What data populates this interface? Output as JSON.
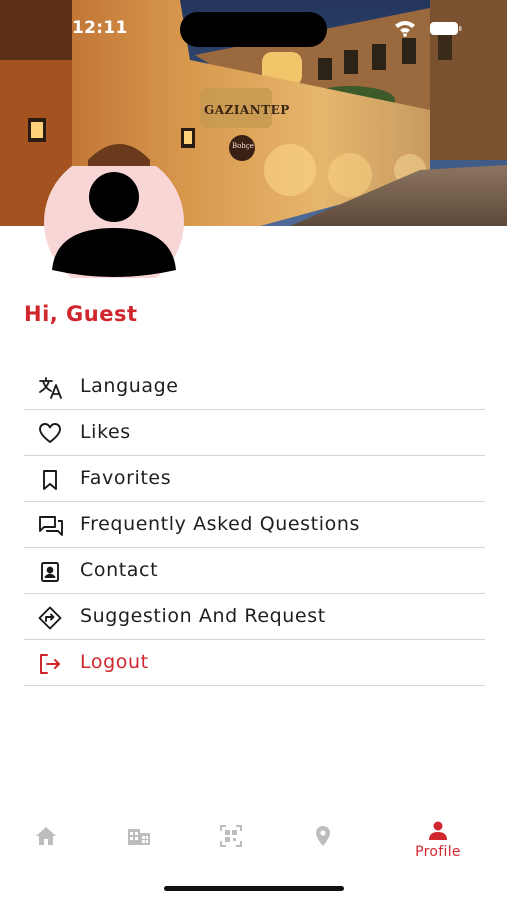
{
  "status_bar": {
    "time": "12:11"
  },
  "hero": {
    "sign_text": "GAZIANTEP",
    "sign_small": "Bohçe"
  },
  "profile": {
    "greeting": "Hi, Guest"
  },
  "menu": [
    {
      "label": "Language",
      "icon": "translate-icon"
    },
    {
      "label": "Likes",
      "icon": "heart-icon"
    },
    {
      "label": "Favorites",
      "icon": "bookmark-icon"
    },
    {
      "label": "Frequently Asked Questions",
      "icon": "chat-icon"
    },
    {
      "label": "Contact",
      "icon": "contact-card-icon"
    },
    {
      "label": "Suggestion And Request",
      "icon": "directions-icon"
    },
    {
      "label": "Logout",
      "icon": "logout-icon"
    }
  ],
  "bottom_nav": {
    "items": [
      {
        "icon": "home-icon"
      },
      {
        "icon": "building-icon"
      },
      {
        "icon": "qr-scan-icon"
      },
      {
        "icon": "location-pin-icon"
      },
      {
        "icon": "person-icon",
        "label": "Profile",
        "active": true
      }
    ]
  },
  "colors": {
    "accent": "#d0262e",
    "inactive_icon": "#bdbdbd",
    "divider": "#d6d6d6"
  }
}
